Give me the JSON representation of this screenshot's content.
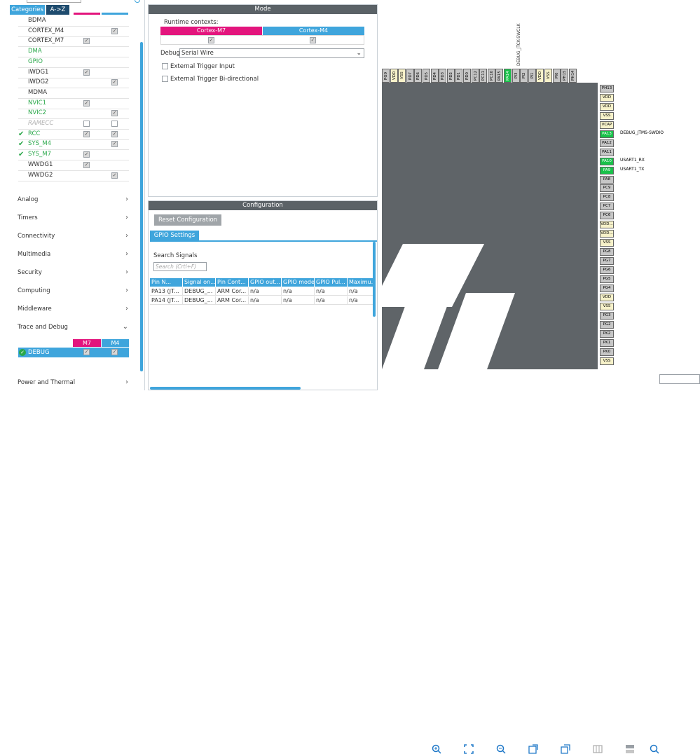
{
  "left": {
    "tabs": [
      "Categories",
      "A->Z"
    ],
    "peripherals": [
      {
        "name": "BDMA",
        "checked": false,
        "style": "normal",
        "m7": null,
        "m4": null
      },
      {
        "name": "CORTEX_M4",
        "checked": false,
        "style": "normal",
        "m7": null,
        "m4": true
      },
      {
        "name": "CORTEX_M7",
        "checked": false,
        "style": "normal",
        "m7": true,
        "m4": null
      },
      {
        "name": "DMA",
        "checked": false,
        "style": "green",
        "m7": null,
        "m4": null
      },
      {
        "name": "GPIO",
        "checked": false,
        "style": "green",
        "m7": null,
        "m4": null
      },
      {
        "name": "IWDG1",
        "checked": false,
        "style": "normal",
        "m7": true,
        "m4": null
      },
      {
        "name": "IWDG2",
        "checked": false,
        "style": "normal",
        "m7": null,
        "m4": true
      },
      {
        "name": "MDMA",
        "checked": false,
        "style": "normal",
        "m7": null,
        "m4": null
      },
      {
        "name": "NVIC1",
        "checked": false,
        "style": "green",
        "m7": true,
        "m4": null
      },
      {
        "name": "NVIC2",
        "checked": false,
        "style": "green",
        "m7": null,
        "m4": true
      },
      {
        "name": "RAMECC",
        "checked": false,
        "style": "disabled",
        "m7": false,
        "m4": false
      },
      {
        "name": "RCC",
        "checked": true,
        "style": "green",
        "m7": true,
        "m4": true
      },
      {
        "name": "SYS_M4",
        "checked": true,
        "style": "green",
        "m7": null,
        "m4": true
      },
      {
        "name": "SYS_M7",
        "checked": true,
        "style": "green",
        "m7": true,
        "m4": null
      },
      {
        "name": "WWDG1",
        "checked": false,
        "style": "normal",
        "m7": true,
        "m4": null
      },
      {
        "name": "WWDG2",
        "checked": false,
        "style": "normal",
        "m7": null,
        "m4": true
      }
    ],
    "categories": [
      "Analog",
      "Timers",
      "Connectivity",
      "Multimedia",
      "Security",
      "Computing",
      "Middleware",
      "Trace and Debug"
    ],
    "debug_table": {
      "col_m7": "M7",
      "col_m4": "M4",
      "row": "DEBUG"
    },
    "bottom_category": "Power and Thermal"
  },
  "mode": {
    "title": "Mode",
    "runtime_label": "Runtime contexts:",
    "ctx_m7": "Cortex-M7",
    "ctx_m4": "Cortex-M4",
    "debug_label": "Debug",
    "debug_value": "Serial Wire",
    "opt1": "External Trigger Input",
    "opt2": "External Trigger Bi-directional"
  },
  "config": {
    "title": "Configuration",
    "reset_button": "Reset Configuration",
    "tab": "GPIO Settings",
    "search_label": "Search Signals",
    "search_placeholder": "Search (Crtl+F)",
    "columns": [
      "Pin N...",
      "Signal on...",
      "Pin Cont...",
      "GPIO out...",
      "GPIO mode",
      "GPIO Pul...",
      "Maximu..."
    ],
    "rows": [
      [
        "PA13 (JT...",
        "DEBUG_...",
        "ARM Cor...",
        "n/a",
        "n/a",
        "n/a",
        "n/a"
      ],
      [
        "PA14 (JT...",
        "DEBUG_...",
        "ARM Cor...",
        "n/a",
        "n/a",
        "n/a",
        "n/a"
      ]
    ]
  },
  "chip": {
    "top_label": "DEBUG_JTCK-SWCLK",
    "top_pins": [
      "PG9",
      "VDD",
      "VSS",
      "PD7",
      "PD6",
      "PD5",
      "PD4",
      "PD3",
      "PD2",
      "PD1",
      "PD0",
      "PC12",
      "PC11",
      "PC10",
      "PA15",
      "PA14",
      "PI3",
      "PI2",
      "PI1",
      "VDD",
      "VSS",
      "PI0",
      "PH15",
      "PH14"
    ],
    "right_pins": [
      "PH13",
      "VDD",
      "VDD",
      "VSS",
      "VCAP",
      "PA13",
      "PA12",
      "PA11",
      "PA10",
      "PA9",
      "PA8",
      "PC9",
      "PC8",
      "PC7",
      "PC6",
      "VDD...",
      "VDD...",
      "VSS",
      "PG8",
      "PG7",
      "PG6",
      "PG5",
      "PG4",
      "VDD",
      "VSS",
      "PG3",
      "PG2",
      "PK2",
      "PK1",
      "PK0",
      "VSS"
    ],
    "label_pa13": "DEBUG_JTMS-SWDIO",
    "label_pa10": "USART1_RX",
    "label_pa9": "USART1_TX"
  }
}
